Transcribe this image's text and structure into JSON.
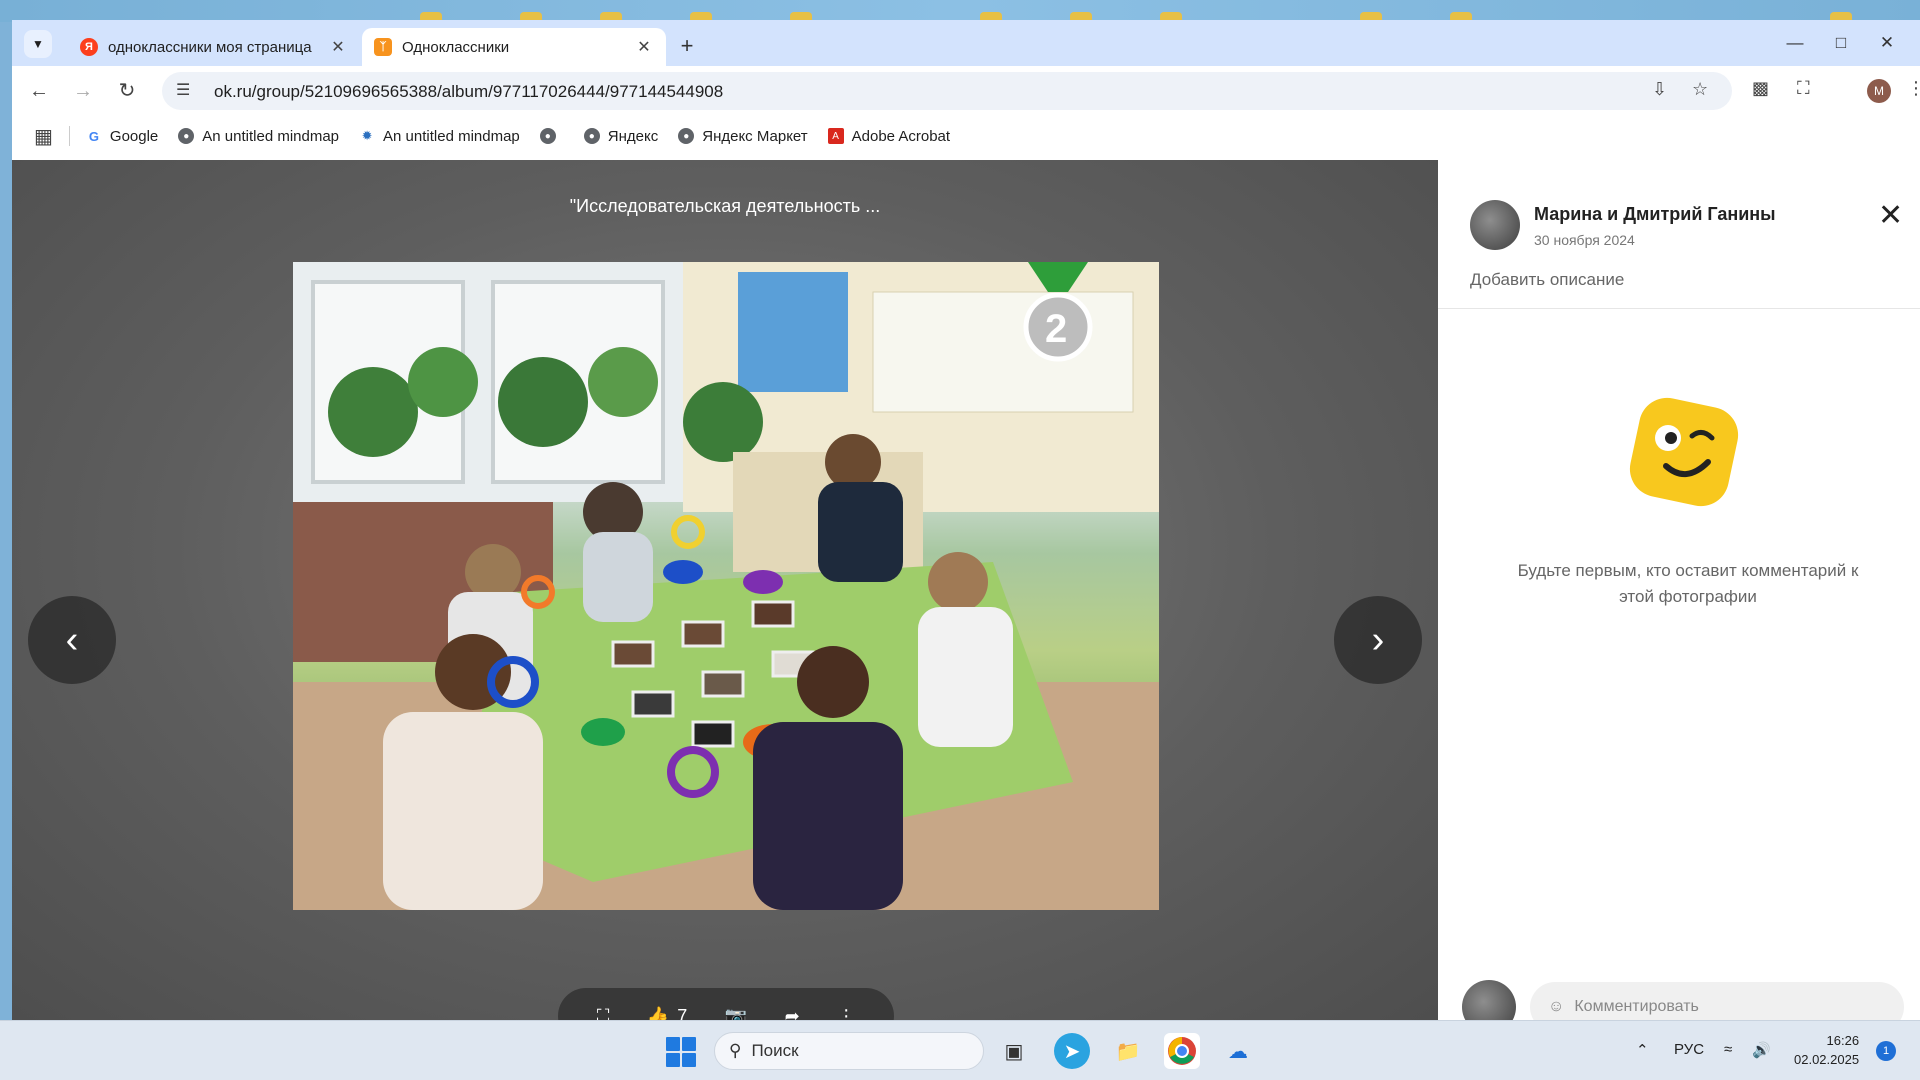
{
  "browser": {
    "tabs": [
      {
        "label": "одноклассники моя страница",
        "active": false
      },
      {
        "label": "Одноклассники",
        "active": true
      }
    ],
    "url": "ok.ru/group/52109696565388/album/977117026444/977144544908",
    "bookmarks": [
      {
        "label": "Google",
        "icon": "google-icon"
      },
      {
        "label": "An untitled mindmap",
        "icon": "globe-icon"
      },
      {
        "label": "An untitled mindmap",
        "icon": "mindmap-icon"
      },
      {
        "label": "",
        "icon": "globe-icon"
      },
      {
        "label": "Яндекс",
        "icon": "globe-icon"
      },
      {
        "label": "Яндекс Маркет",
        "icon": "globe-icon"
      },
      {
        "label": "Adobe Acrobat",
        "icon": "acrobat-icon"
      }
    ],
    "profile_initial": "M"
  },
  "viewer": {
    "title": "\"Исследовательская деятельность ...",
    "likes": "7"
  },
  "sidebar": {
    "owner": "Марина и Дмитрий Ганины",
    "date": "30 ноября 2024",
    "add_description": "Добавить описание",
    "empty_text": "Будьте первым, кто оставит комментарий к этой фотографии",
    "comment_placeholder": "Комментировать"
  },
  "taskbar": {
    "search_label": "Поиск",
    "language": "РУС",
    "time": "16:26",
    "date": "02.02.2025",
    "notifications": "1"
  }
}
